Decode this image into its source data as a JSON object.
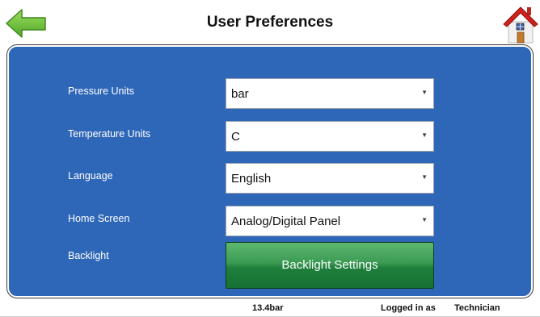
{
  "header": {
    "title": "User Preferences"
  },
  "icons": {
    "back": "back-arrow-icon",
    "home": "home-icon"
  },
  "colors": {
    "panel_background": "#2f67b8",
    "back_arrow": "#7ac943",
    "home_roof": "#d0211c",
    "button_green": "#2e8b47"
  },
  "preferences": {
    "pressure_units": {
      "label": "Pressure Units",
      "value": "bar"
    },
    "temperature_units": {
      "label": "Temperature Units",
      "value": "C"
    },
    "language": {
      "label": "Language",
      "value": "English"
    },
    "home_screen": {
      "label": "Home Screen",
      "value": "Analog/Digital Panel"
    },
    "backlight": {
      "label": "Backlight",
      "button_label": "Backlight Settings"
    }
  },
  "status_bar": {
    "pressure_reading": "13.4bar",
    "logged_in_label": "Logged in as",
    "user_role": "Technician"
  }
}
